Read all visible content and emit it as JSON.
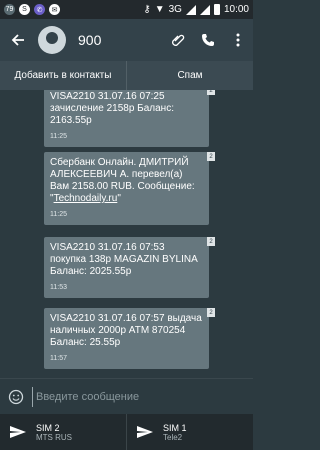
{
  "status": {
    "network": "3G",
    "time": "10:00",
    "colors": {
      "bar": "#23292d"
    }
  },
  "appbar": {
    "title": "900",
    "back_icon": "arrow-left-icon",
    "attach_icon": "paperclip-icon",
    "call_icon": "phone-icon",
    "menu_icon": "more-vert-icon"
  },
  "actions": {
    "add_contact": "Добавить в контакты",
    "spam": "Спам"
  },
  "messages": [
    {
      "text": "VISA2210 31.07.16 07:25 зачисление 2158р Баланс: 2163.55р",
      "time": "11:25",
      "sim": "2"
    },
    {
      "text_before": "Сбербанк Онлайн. ДМИТРИЙ АЛЕКСЕЕВИЧ А. перевел(а) Вам 2158.00 RUB. Сообщение: \"",
      "link": "Technodaily.ru",
      "text_after": "\"",
      "time": "11:25",
      "sim": "2"
    },
    {
      "text": "VISA2210 31.07.16 07:53 покупка 138р MAGAZIN BYLINA Баланс: 2025.55р",
      "time": "11:53",
      "sim": "2"
    },
    {
      "text": "VISA2210 31.07.16 07:57 выдача наличных 2000р ATM 870254 Баланс: 25.55р",
      "time": "11:57",
      "sim": "2"
    }
  ],
  "composer": {
    "placeholder": "Введите сообщение"
  },
  "sims": [
    {
      "name": "SIM 2",
      "operator": "MTS RUS"
    },
    {
      "name": "SIM 1",
      "operator": "Tele2"
    }
  ]
}
